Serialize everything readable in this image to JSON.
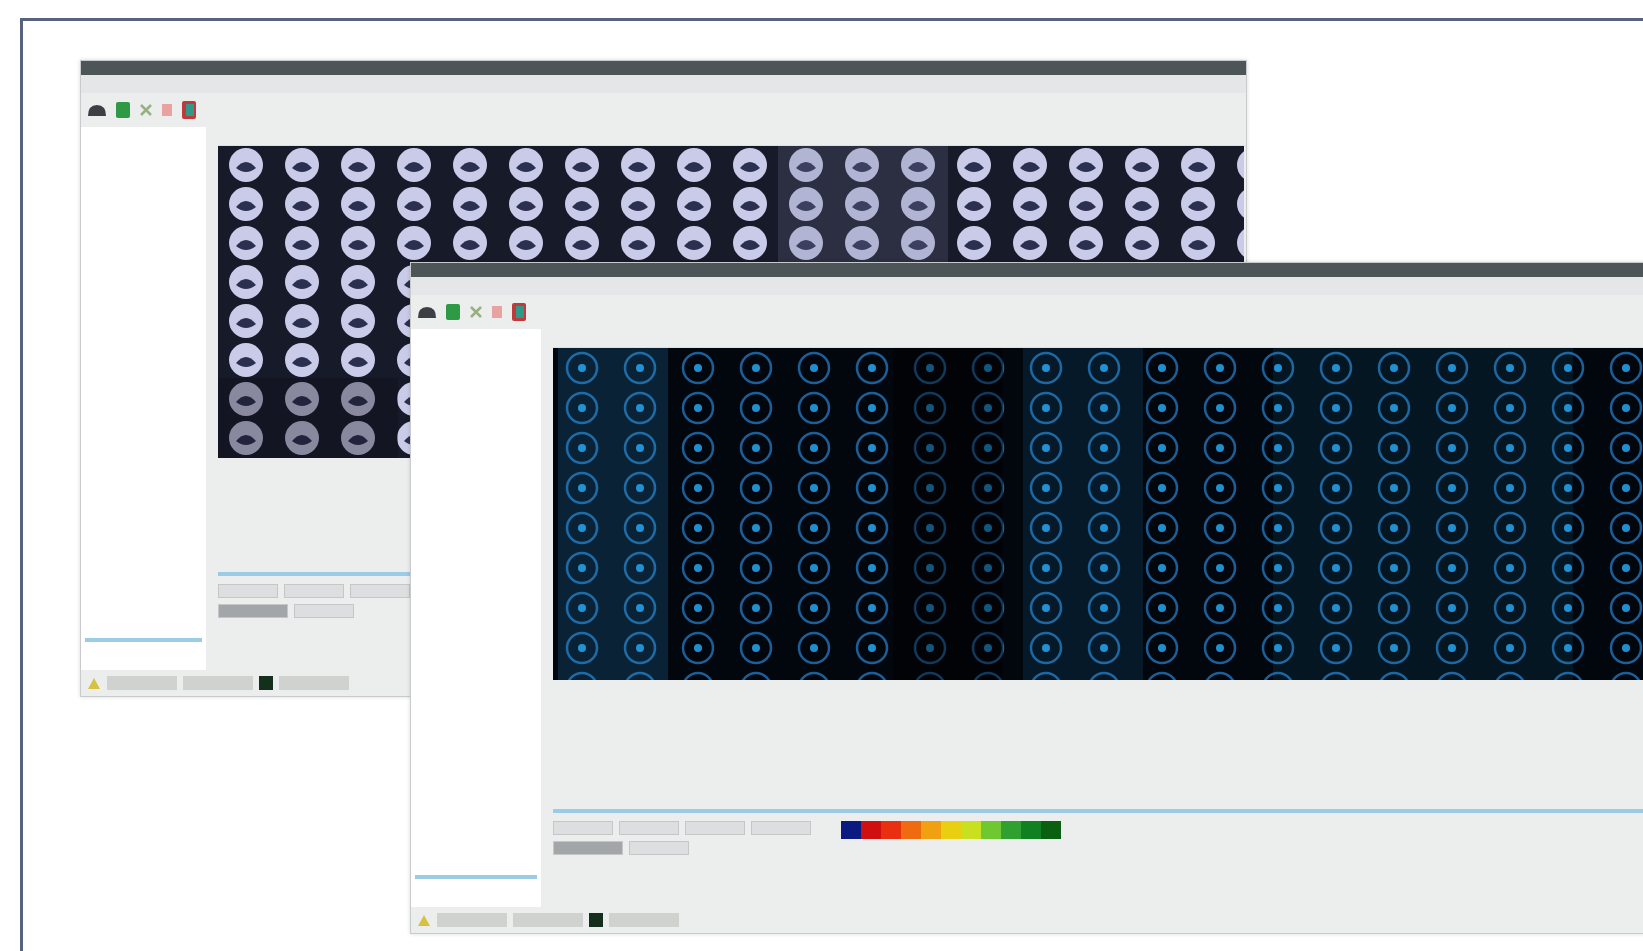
{
  "windows": [
    {
      "kind": "brightfield"
    },
    {
      "kind": "fluorescence"
    }
  ]
}
